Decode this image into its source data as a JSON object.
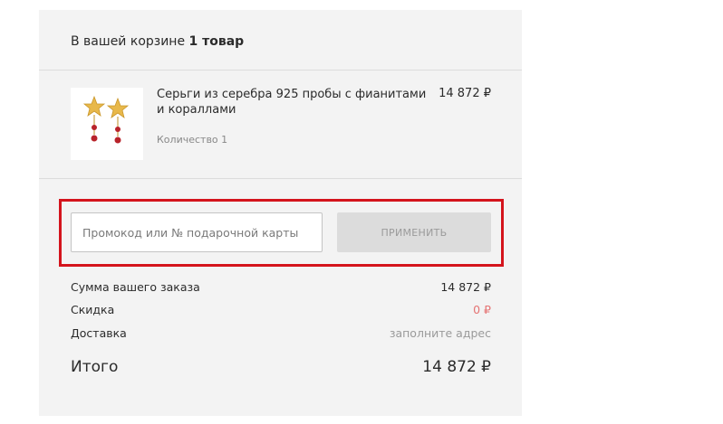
{
  "cart": {
    "header_prefix": "В вашей корзине",
    "header_count": "1 товар"
  },
  "item": {
    "image_icon": "earrings-thumbnail",
    "name": "Серьги из серебра 925 пробы с фианитами и кораллами",
    "price": "14 872 ₽",
    "quantity": "Количество 1"
  },
  "promo": {
    "placeholder": "Промокод или № подарочной карты",
    "value": "",
    "apply_label": "ПРИМЕНИТЬ",
    "highlight_color": "#d4141c"
  },
  "summary": {
    "order_sum_label": "Сумма вашего заказа",
    "order_sum_value": "14 872 ₽",
    "discount_label": "Скидка",
    "discount_value": "0 ₽",
    "delivery_label": "Доставка",
    "delivery_value": "заполните адрес",
    "total_label": "Итого",
    "total_value": "14 872 ₽"
  },
  "colors": {
    "panel_bg": "#f3f3f3",
    "discount": "#e57373",
    "muted": "#9a9a9a"
  }
}
